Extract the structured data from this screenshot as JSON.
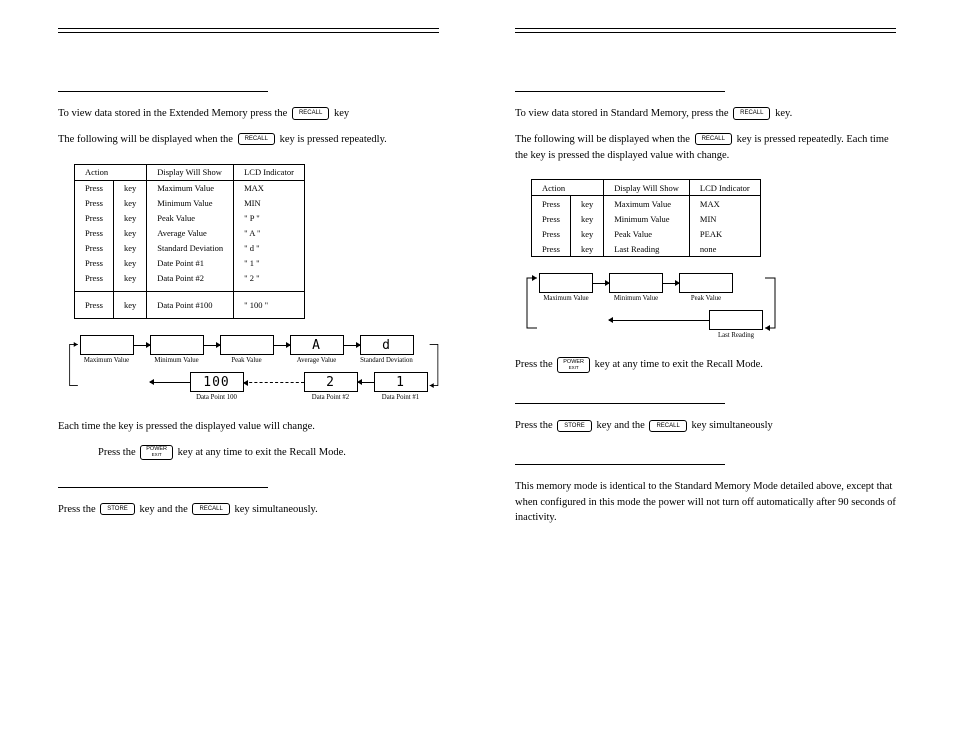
{
  "keys": {
    "recall": "RECALL",
    "store": "STORE",
    "power": "POWER",
    "exit": "EXIT"
  },
  "left": {
    "intro1a": "To view data stored in the Extended Memory press the",
    "intro1b": "key",
    "intro2a": "The following will be displayed when the",
    "intro2b": "key is pressed repeatedly.",
    "tableHeaders": {
      "action": "Action",
      "show": "Display Will Show",
      "ind": "LCD Indicator"
    },
    "rows": [
      [
        "Press",
        "key",
        "Maximum Value",
        "MAX"
      ],
      [
        "Press",
        "key",
        "Minimum Value",
        "MIN"
      ],
      [
        "Press",
        "key",
        "Peak Value",
        "\" P \""
      ],
      [
        "Press",
        "key",
        "Average Value",
        "\" A \""
      ],
      [
        "Press",
        "key",
        "Standard Deviation",
        "\" d \""
      ],
      [
        "Press",
        "key",
        "Date Point #1",
        "\" 1 \""
      ],
      [
        "Press",
        "key",
        "Data Point #2",
        "\" 2 \""
      ]
    ],
    "rowGap": [
      "Press",
      "key",
      "Data Point #100",
      "\" 100 \""
    ],
    "flowTop": [
      "Maximum Value",
      "Minimum Value",
      "Peak Value",
      "Average Value",
      "Standard Deviation"
    ],
    "flowTopDisp": [
      "",
      "",
      "",
      "A",
      "d"
    ],
    "flowBot": [
      "Data Point 100",
      "Data Point #2",
      "Data Point #1"
    ],
    "flowBotDisp": [
      "100",
      "2",
      "1"
    ],
    "after1": "Each time the key is pressed the displayed value will change.",
    "after2a": "Press the",
    "after2b": "key at any time to exit the Recall Mode.",
    "clear1a": "Press the",
    "clear1b": "key and the",
    "clear1c": "key simultaneously."
  },
  "right": {
    "intro1a": "To view data stored in Standard Memory, press the",
    "intro1b": "key.",
    "intro2a": "The following will be displayed when the",
    "intro2b": "key is pressed repeatedly. Each time the key is pressed the displayed value with change.",
    "tableHeaders": {
      "action": "Action",
      "show": "Display Will Show",
      "ind": "LCD Indicator"
    },
    "rows": [
      [
        "Press",
        "key",
        "Maximum Value",
        "MAX"
      ],
      [
        "Press",
        "key",
        "Minimum Value",
        "MIN"
      ],
      [
        "Press",
        "key",
        "Peak Value",
        "PEAK"
      ],
      [
        "Press",
        "key",
        "Last Reading",
        "none"
      ]
    ],
    "flowTop": [
      "Maximum Value",
      "Minimum Value",
      "Peak Value"
    ],
    "flowLast": "Last Reading",
    "after2a": "Press the",
    "after2b": "key at any time to exit the Recall Mode.",
    "clear1a": "Press the",
    "clear1b": "key and the",
    "clear1c": "key simultaneously",
    "noteMode": "This memory mode is identical to the Standard Memory Mode detailed above, except that when configured in this mode the power will not turn off automatically after 90 seconds of  inactivity."
  }
}
